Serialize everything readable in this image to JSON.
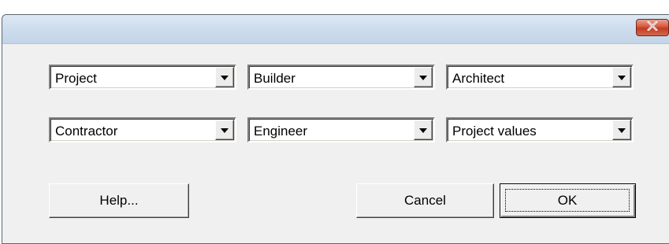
{
  "dialog": {
    "close_icon": "close-x-icon"
  },
  "fields": [
    {
      "name": "project",
      "value": "Project"
    },
    {
      "name": "builder",
      "value": "Builder"
    },
    {
      "name": "architect",
      "value": "Architect"
    },
    {
      "name": "contractor",
      "value": "Contractor"
    },
    {
      "name": "engineer",
      "value": "Engineer"
    },
    {
      "name": "project-values",
      "value": "Project values"
    }
  ],
  "buttons": {
    "help": "Help...",
    "cancel": "Cancel",
    "ok": "OK"
  },
  "colors": {
    "title_bar": "#cfdeee",
    "close_button": "#c13b22",
    "dialog_bg": "#f0f0f0"
  }
}
